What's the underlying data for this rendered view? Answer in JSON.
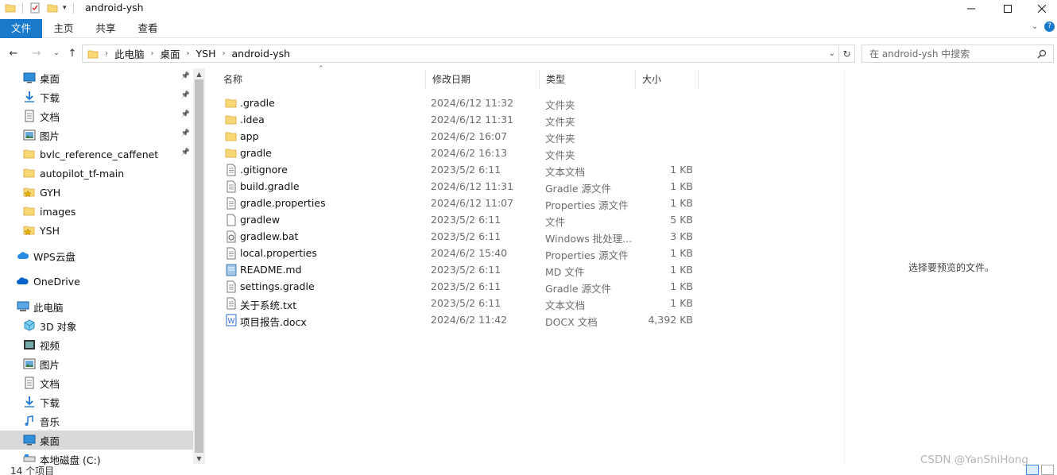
{
  "window": {
    "title": "android-ysh"
  },
  "ribbon": {
    "tabs": [
      "文件",
      "主页",
      "共享",
      "查看"
    ]
  },
  "address": {
    "crumbs": [
      "此电脑",
      "桌面",
      "YSH",
      "android-ysh"
    ]
  },
  "search": {
    "placeholder": "在 android-ysh 中搜索"
  },
  "nav": {
    "items": [
      {
        "label": "桌面",
        "icon": "desktop-icon",
        "pinned": true
      },
      {
        "label": "下载",
        "icon": "download-icon",
        "pinned": true
      },
      {
        "label": "文档",
        "icon": "document-icon",
        "pinned": true
      },
      {
        "label": "图片",
        "icon": "picture-icon",
        "pinned": true
      },
      {
        "label": "bvlc_reference_caffenet",
        "icon": "folder-icon",
        "pinned": true
      },
      {
        "label": "autopilot_tf-main",
        "icon": "folder-icon",
        "pinned": false
      },
      {
        "label": "GYH",
        "icon": "star-folder-icon",
        "pinned": false
      },
      {
        "label": "images",
        "icon": "folder-icon",
        "pinned": false
      },
      {
        "label": "YSH",
        "icon": "star-folder-icon",
        "pinned": false
      },
      {
        "label": "WPS云盘",
        "icon": "cloud-icon",
        "pinned": false
      },
      {
        "label": "OneDrive",
        "icon": "onedrive-icon",
        "pinned": false
      },
      {
        "label": "此电脑",
        "icon": "computer-icon",
        "pinned": false
      },
      {
        "label": "3D 对象",
        "icon": "3d-objects-icon",
        "pinned": false
      },
      {
        "label": "视频",
        "icon": "video-icon",
        "pinned": false
      },
      {
        "label": "图片",
        "icon": "picture-icon",
        "pinned": false
      },
      {
        "label": "文档",
        "icon": "document-icon",
        "pinned": false
      },
      {
        "label": "下载",
        "icon": "download-icon",
        "pinned": false
      },
      {
        "label": "音乐",
        "icon": "music-icon",
        "pinned": false
      },
      {
        "label": "桌面",
        "icon": "desktop-icon",
        "pinned": false
      },
      {
        "label": "本地磁盘 (C:)",
        "icon": "drive-icon",
        "pinned": false
      }
    ]
  },
  "list": {
    "columns": [
      "名称",
      "修改日期",
      "类型",
      "大小"
    ],
    "files": [
      {
        "name": ".gradle",
        "date": "2024/6/12 11:32",
        "type": "文件夹",
        "size": "",
        "icon": "folder-icon"
      },
      {
        "name": ".idea",
        "date": "2024/6/12 11:31",
        "type": "文件夹",
        "size": "",
        "icon": "folder-icon"
      },
      {
        "name": "app",
        "date": "2024/6/2 16:07",
        "type": "文件夹",
        "size": "",
        "icon": "folder-icon"
      },
      {
        "name": "gradle",
        "date": "2024/6/2 16:13",
        "type": "文件夹",
        "size": "",
        "icon": "folder-icon"
      },
      {
        "name": ".gitignore",
        "date": "2023/5/2 6:11",
        "type": "文本文档",
        "size": "1 KB",
        "icon": "text-file-icon"
      },
      {
        "name": "build.gradle",
        "date": "2024/6/12 11:31",
        "type": "Gradle 源文件",
        "size": "1 KB",
        "icon": "text-file-icon"
      },
      {
        "name": "gradle.properties",
        "date": "2024/6/12 11:07",
        "type": "Properties 源文件",
        "size": "1 KB",
        "icon": "text-file-icon"
      },
      {
        "name": "gradlew",
        "date": "2023/5/2 6:11",
        "type": "文件",
        "size": "5 KB",
        "icon": "blank-file-icon"
      },
      {
        "name": "gradlew.bat",
        "date": "2023/5/2 6:11",
        "type": "Windows 批处理...",
        "size": "3 KB",
        "icon": "batch-file-icon"
      },
      {
        "name": "local.properties",
        "date": "2024/6/2 15:40",
        "type": "Properties 源文件",
        "size": "1 KB",
        "icon": "text-file-icon"
      },
      {
        "name": "README.md",
        "date": "2023/5/2 6:11",
        "type": "MD 文件",
        "size": "1 KB",
        "icon": "markdown-file-icon"
      },
      {
        "name": "settings.gradle",
        "date": "2023/5/2 6:11",
        "type": "Gradle 源文件",
        "size": "1 KB",
        "icon": "text-file-icon"
      },
      {
        "name": "关于系统.txt",
        "date": "2023/5/2 6:11",
        "type": "文本文档",
        "size": "1 KB",
        "icon": "text-file-icon"
      },
      {
        "name": "项目报告.docx",
        "date": "2024/6/2 11:42",
        "type": "DOCX 文档",
        "size": "4,392 KB",
        "icon": "word-file-icon"
      }
    ]
  },
  "preview": {
    "message": "选择要预览的文件。"
  },
  "status": {
    "count": "14 个项目"
  },
  "watermark": "CSDN @YanShiHong",
  "colors": {
    "accent": "#1979ca",
    "folder": "#f8d775",
    "selected_nav": "#d9d9d9"
  }
}
